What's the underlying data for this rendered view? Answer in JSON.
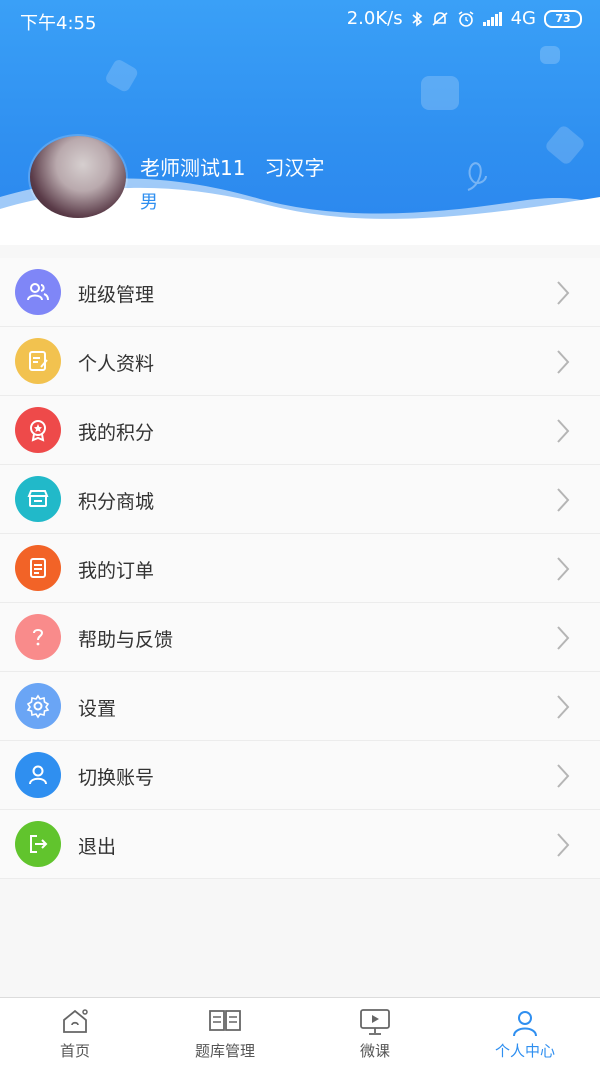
{
  "status_bar": {
    "time": "下午4:55",
    "network_speed": "2.0K/s",
    "network_type": "4G",
    "battery": "73"
  },
  "profile": {
    "name": "老师测试11",
    "nickname": "习汉字",
    "gender": "男"
  },
  "menu": [
    {
      "label": "班级管理",
      "icon": "class-users-icon",
      "color": "#7f86f7"
    },
    {
      "label": "个人资料",
      "icon": "profile-edit-icon",
      "color": "#f2c24f"
    },
    {
      "label": "我的积分",
      "icon": "medal-icon",
      "color": "#ee4a4a"
    },
    {
      "label": "积分商城",
      "icon": "store-icon",
      "color": "#21b9c9"
    },
    {
      "label": "我的订单",
      "icon": "order-icon",
      "color": "#f26327"
    },
    {
      "label": "帮助与反馈",
      "icon": "help-icon",
      "color": "#f98b8b"
    },
    {
      "label": "设置",
      "icon": "gear-icon",
      "color": "#6aa5f5"
    },
    {
      "label": "切换账号",
      "icon": "switch-account-icon",
      "color": "#2f8ff0"
    },
    {
      "label": "退出",
      "icon": "logout-icon",
      "color": "#61c42d"
    }
  ],
  "tabbar": {
    "tabs": [
      {
        "label": "首页",
        "icon": "home-icon"
      },
      {
        "label": "题库管理",
        "icon": "book-icon"
      },
      {
        "label": "微课",
        "icon": "video-icon"
      },
      {
        "label": "个人中心",
        "icon": "person-icon"
      }
    ],
    "active_index": 3,
    "active_color": "#2f8ff0"
  }
}
